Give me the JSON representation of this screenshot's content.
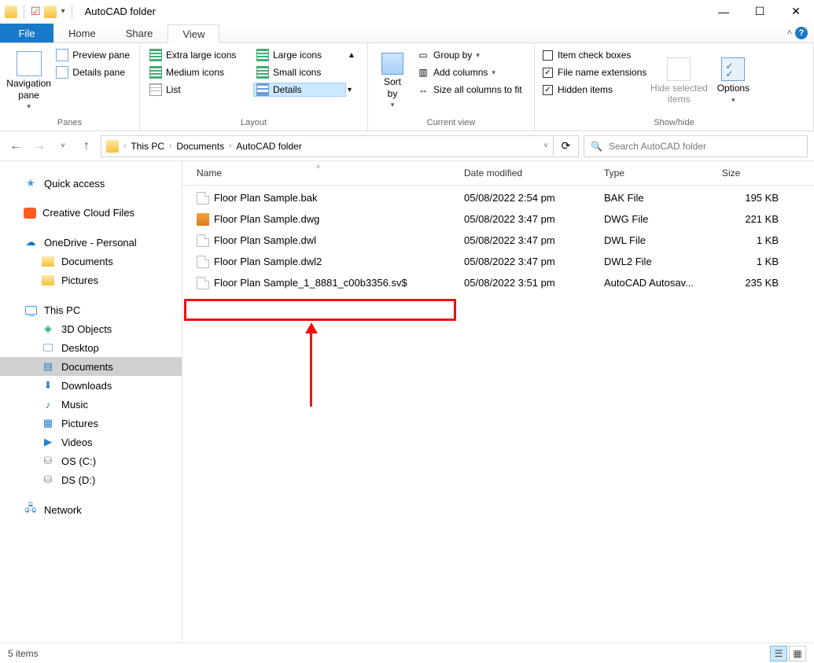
{
  "title": "AutoCAD folder",
  "tabs": {
    "file": "File",
    "home": "Home",
    "share": "Share",
    "view": "View"
  },
  "ribbon": {
    "panes": {
      "nav": "Navigation\npane",
      "preview": "Preview pane",
      "details": "Details pane",
      "group": "Panes"
    },
    "layout": {
      "xlarge": "Extra large icons",
      "large": "Large icons",
      "medium": "Medium icons",
      "small": "Small icons",
      "list": "List",
      "details": "Details",
      "group": "Layout"
    },
    "currentview": {
      "sort": "Sort\nby",
      "groupby": "Group by",
      "addcols": "Add columns",
      "sizecols": "Size all columns to fit",
      "group": "Current view"
    },
    "showhide": {
      "itemchk": "Item check boxes",
      "ext": "File name extensions",
      "hidden": "Hidden items",
      "hide": "Hide selected\nitems",
      "options": "Options",
      "group": "Show/hide"
    }
  },
  "breadcrumb": {
    "root": "This PC",
    "a": "Documents",
    "b": "AutoCAD folder"
  },
  "search": {
    "placeholder": "Search AutoCAD folder"
  },
  "tree": {
    "quick": "Quick access",
    "ccf": "Creative Cloud Files",
    "onedrive": "OneDrive - Personal",
    "docs": "Documents",
    "pics": "Pictures",
    "thispc": "This PC",
    "obj3d": "3D Objects",
    "desktop": "Desktop",
    "documents": "Documents",
    "downloads": "Downloads",
    "music": "Music",
    "pictures": "Pictures",
    "videos": "Videos",
    "osc": "OS (C:)",
    "dsd": "DS (D:)",
    "network": "Network"
  },
  "cols": {
    "name": "Name",
    "date": "Date modified",
    "type": "Type",
    "size": "Size"
  },
  "files": [
    {
      "name": "Floor Plan Sample.bak",
      "date": "05/08/2022 2:54 pm",
      "type": "BAK File",
      "size": "195 KB",
      "ico": "blank"
    },
    {
      "name": "Floor Plan Sample.dwg",
      "date": "05/08/2022 3:47 pm",
      "type": "DWG File",
      "size": "221 KB",
      "ico": "dwg"
    },
    {
      "name": "Floor Plan Sample.dwl",
      "date": "05/08/2022 3:47 pm",
      "type": "DWL File",
      "size": "1 KB",
      "ico": "blank"
    },
    {
      "name": "Floor Plan Sample.dwl2",
      "date": "05/08/2022 3:47 pm",
      "type": "DWL2 File",
      "size": "1 KB",
      "ico": "blank"
    },
    {
      "name": "Floor Plan Sample_1_8881_c00b3356.sv$",
      "date": "05/08/2022 3:51 pm",
      "type": "AutoCAD Autosav...",
      "size": "235 KB",
      "ico": "blank"
    }
  ],
  "status": "5 items"
}
